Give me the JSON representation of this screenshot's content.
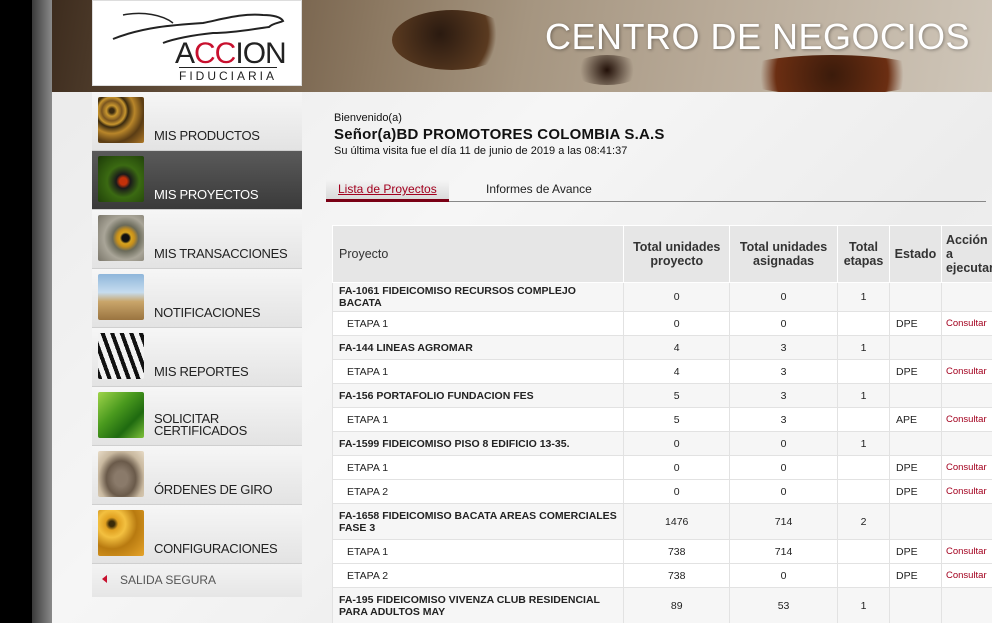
{
  "header": {
    "logo_word_left": "A",
    "logo_word_red": "CC",
    "logo_word_right": "ION",
    "logo_subtitle": "FIDUCIARIA",
    "title": "CENTRO DE NEGOCIOS"
  },
  "sidebar": {
    "items": [
      {
        "label": "MIS PRODUCTOS",
        "icon": "leopard-icon",
        "active": false
      },
      {
        "label": "MIS PROYECTOS",
        "icon": "ant-icon",
        "active": true
      },
      {
        "label": "MIS TRANSACCIONES",
        "icon": "owl-eye-icon",
        "active": false
      },
      {
        "label": "NOTIFICACIONES",
        "icon": "camel-icon",
        "active": false
      },
      {
        "label": "MIS REPORTES",
        "icon": "zebra-icon",
        "active": false
      },
      {
        "label": "SOLICITAR CERTIFICADOS",
        "icon": "leaf-icon",
        "active": false
      },
      {
        "label": "ÓRDENES DE GIRO",
        "icon": "elephant-icon",
        "active": false
      },
      {
        "label": "CONFIGURACIONES",
        "icon": "honeycomb-icon",
        "active": false
      }
    ],
    "exit_label": "SALIDA SEGURA"
  },
  "welcome": {
    "greeting": "Bienvenido(a)",
    "name": "Señor(a)BD PROMOTORES COLOMBIA S.A.S",
    "last_visit": "Su última visita fue el día 11 de junio de 2019 a las 08:41:37"
  },
  "tabs": [
    {
      "label": "Lista de Proyectos",
      "active": true
    },
    {
      "label": "Informes de Avance",
      "active": false
    }
  ],
  "table": {
    "headers": {
      "project": "Proyecto",
      "total_units": "Total unidades proyecto",
      "assigned_units": "Total unidades asignadas",
      "total_stages": "Total etapas",
      "state": "Estado",
      "action": "Acción a ejecutar"
    },
    "rows": [
      {
        "type": "project",
        "name": "FA-1061 FIDEICOMISO RECURSOS COMPLEJO BACATA",
        "total": "0",
        "assigned": "0",
        "stages": "1",
        "state": "",
        "action": ""
      },
      {
        "type": "stage",
        "name": "ETAPA 1",
        "total": "0",
        "assigned": "0",
        "stages": "",
        "state": "DPE",
        "action": "Consultar"
      },
      {
        "type": "project",
        "name": "FA-144 LINEAS AGROMAR",
        "total": "4",
        "assigned": "3",
        "stages": "1",
        "state": "",
        "action": ""
      },
      {
        "type": "stage",
        "name": "ETAPA 1",
        "total": "4",
        "assigned": "3",
        "stages": "",
        "state": "DPE",
        "action": "Consultar"
      },
      {
        "type": "project",
        "name": "FA-156 PORTAFOLIO FUNDACION FES",
        "total": "5",
        "assigned": "3",
        "stages": "1",
        "state": "",
        "action": ""
      },
      {
        "type": "stage",
        "name": "ETAPA 1",
        "total": "5",
        "assigned": "3",
        "stages": "",
        "state": "APE",
        "action": "Consultar"
      },
      {
        "type": "project",
        "name": "FA-1599 FIDEICOMISO PISO 8 EDIFICIO 13-35.",
        "total": "0",
        "assigned": "0",
        "stages": "1",
        "state": "",
        "action": ""
      },
      {
        "type": "stage",
        "name": "ETAPA 1",
        "total": "0",
        "assigned": "0",
        "stages": "",
        "state": "DPE",
        "action": "Consultar"
      },
      {
        "type": "stage",
        "name": "ETAPA 2",
        "total": "0",
        "assigned": "0",
        "stages": "",
        "state": "DPE",
        "action": "Consultar"
      },
      {
        "type": "project",
        "name": "FA-1658 FIDEICOMISO BACATA AREAS COMERCIALES FASE 3",
        "total": "1476",
        "assigned": "714",
        "stages": "2",
        "state": "",
        "action": ""
      },
      {
        "type": "stage",
        "name": "ETAPA 1",
        "total": "738",
        "assigned": "714",
        "stages": "",
        "state": "DPE",
        "action": "Consultar"
      },
      {
        "type": "stage",
        "name": "ETAPA 2",
        "total": "738",
        "assigned": "0",
        "stages": "",
        "state": "DPE",
        "action": "Consultar"
      },
      {
        "type": "project",
        "name": "FA-195 FIDEICOMISO VIVENZA CLUB RESIDENCIAL PARA ADULTOS MAY",
        "total": "89",
        "assigned": "53",
        "stages": "1",
        "state": "",
        "action": ""
      }
    ]
  },
  "colors": {
    "accent_red": "#a3001e",
    "active_menu": "#3a3a3a"
  }
}
